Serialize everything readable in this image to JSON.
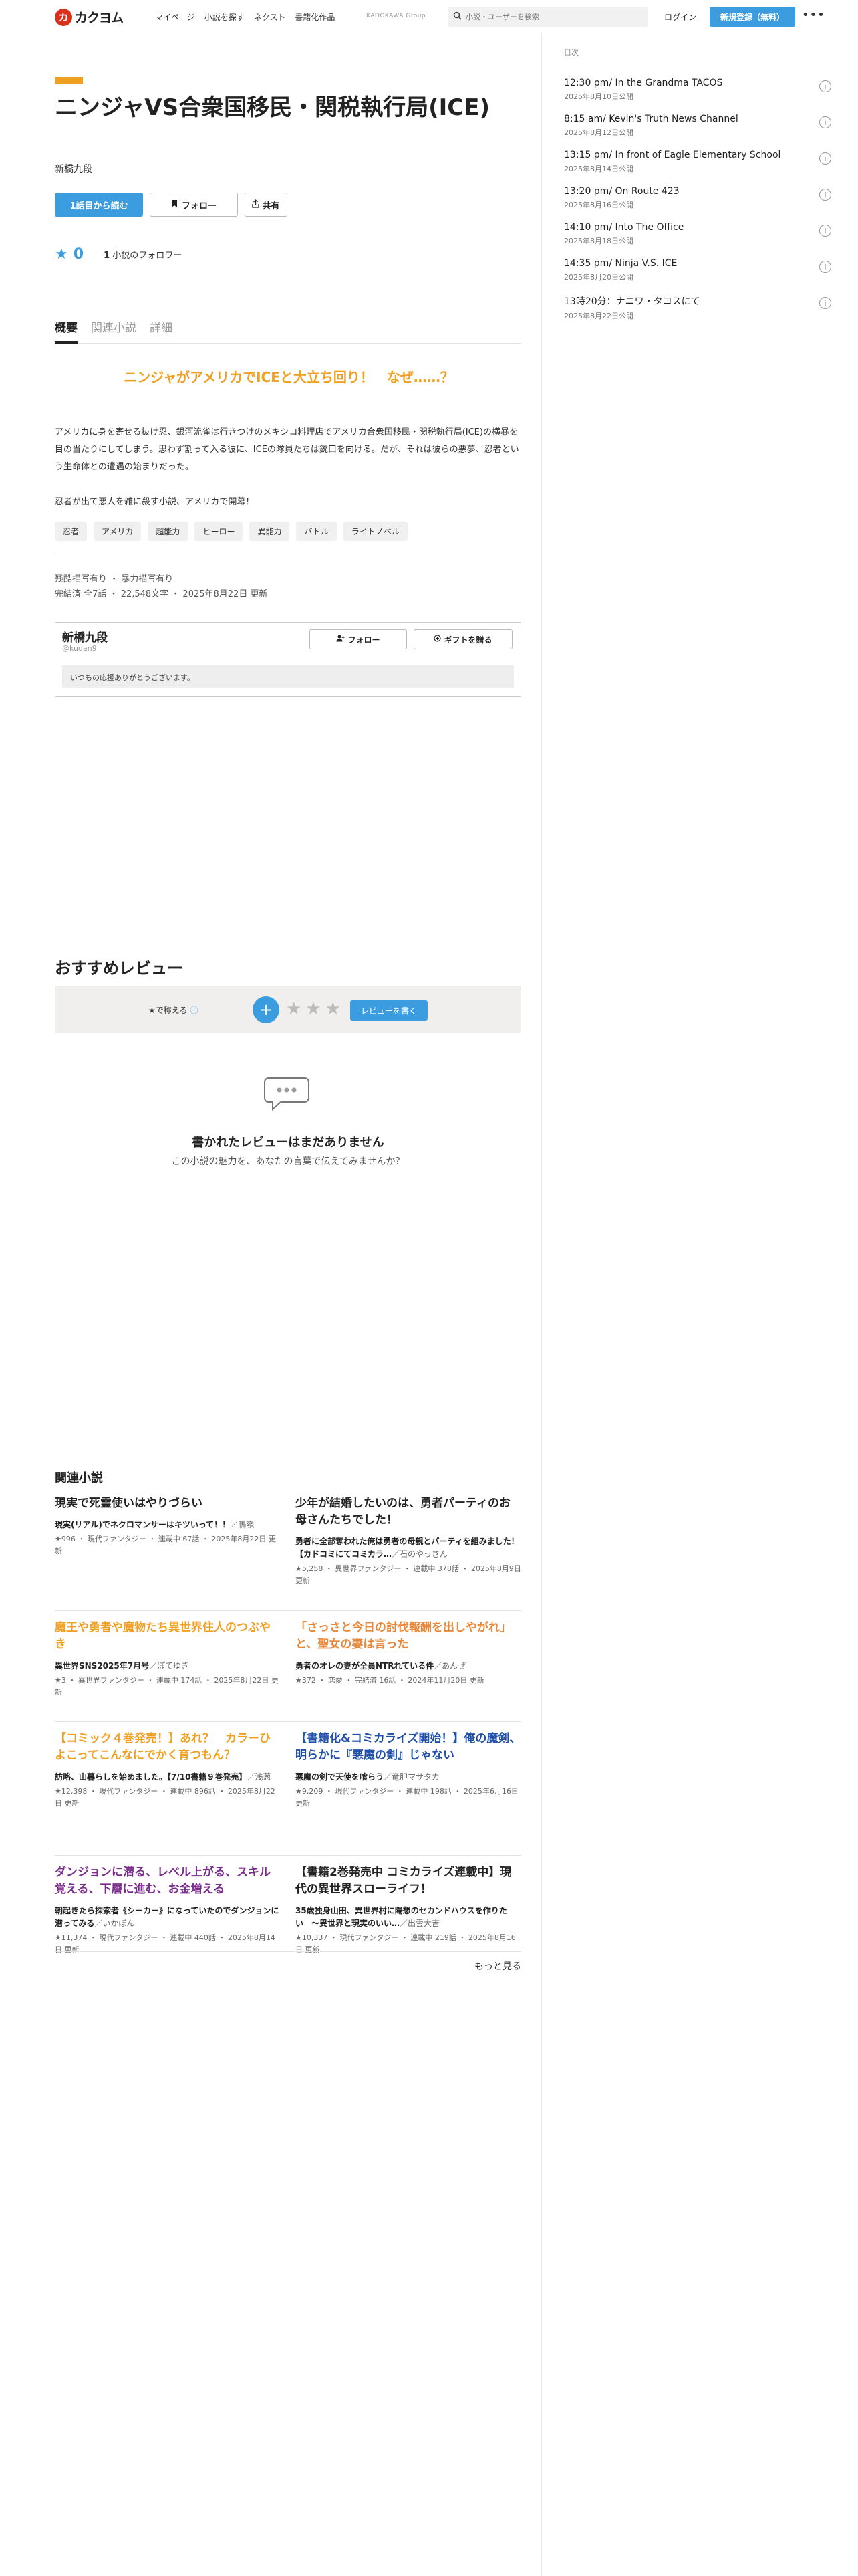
{
  "header": {
    "logo_mark": "カ",
    "logo_text": "カクヨム",
    "nav": [
      "マイページ",
      "小説を探す",
      "ネクスト",
      "書籍化作品"
    ],
    "group": "KADOKAWA Group",
    "search_placeholder": "小説・ユーザーを検索",
    "login": "ログイン",
    "signup": "新規登録（無料）",
    "more": "•••"
  },
  "work": {
    "title": "ニンジャVS合衆国移民・関税執行局(ICE)",
    "author": "新橋九段",
    "read_button": "1話目から読む",
    "follow_button": "フォロー",
    "share_button": "共有",
    "star_count": "0",
    "follower_count": "1",
    "follower_text": "小説のフォロワー"
  },
  "tabs": [
    "概要",
    "関連小説",
    "詳細"
  ],
  "overview": {
    "catchphrase": "ニンジャがアメリカでICEと大立ち回り！　なぜ……？",
    "intro_1": "アメリカに身を寄せる抜け忍、銀河流雀は行きつけのメキシコ料理店でアメリカ合衆国移民・関税執行局(ICE)の横暴を目の当たりにしてしまう。思わず割って入る彼に、ICEの隊員たちは銃口を向ける。だが、それは彼らの悪夢、忍者という生命体との遭遇の始まりだった。",
    "intro_2": "忍者が出て悪人を雑に殺す小説、アメリカで開幕！",
    "tags": [
      "忍者",
      "アメリカ",
      "超能力",
      "ヒーロー",
      "異能力",
      "バトル",
      "ライトノベル"
    ],
    "warnings": "残酷描写有り ・ 暴力描写有り",
    "stats": "完結済 全7話 ・ 22,548文字 ・ 2025年8月22日 更新"
  },
  "author_box": {
    "name": "新橋九段",
    "id": "@kudan9",
    "follow": "フォロー",
    "gift": "ギフトを贈る",
    "message": "いつもの応援ありがとうございます。"
  },
  "reviews": {
    "heading": "おすすめレビュー",
    "label": "★で称える",
    "help": "ⓘ",
    "plus": "+",
    "stars": "★★★",
    "write": "レビューを書く",
    "empty_title": "書かれたレビューはまだありません",
    "empty_sub": "この小説の魅力を、あなたの言葉で伝えてみませんか？"
  },
  "related": {
    "heading": "関連小説",
    "more": "もっと見る",
    "items": [
      {
        "title": "現実で死霊使いはやりづらい",
        "title_color": "#222222",
        "catch": "現実(リアル)でネクロマンサーはキツいって！！",
        "author": "／鴨嶺",
        "meta": "★996 ・ 現代ファンタジー ・ 連載中 67話 ・ 2025年8月22日 更新"
      },
      {
        "title": "少年が結婚したいのは、勇者パーティのお母さんたちでした！",
        "title_color": "#222222",
        "catch": "勇者に全部奪われた俺は勇者の母親とパーティを組みました！【カドコミにてコミカラ…",
        "author": "／石のやっさん",
        "meta": "★5,258 ・ 異世界ファンタジー ・ 連載中 378話 ・ 2025年8月9日 更新"
      },
      {
        "title": "魔王や勇者や魔物たち異世界住人のつぶやき",
        "title_color": "#f0a021",
        "catch": "異世界SNS2025年7月号",
        "author": "／ぽてゆき",
        "meta": "★3 ・ 異世界ファンタジー ・ 連載中 174話 ・ 2025年8月22日 更新"
      },
      {
        "title": "「さっさと今日の討伐報酬を出しやがれ」と、聖女の妻は言った",
        "title_color": "#e8883a",
        "catch": "勇者のオレの妻が全員NTRれている件",
        "author": "／あんぜ",
        "meta": "★372 ・ 恋愛 ・ 完結済 16話 ・ 2024年11月20日 更新"
      },
      {
        "title": "【コミック４巻発売！】あれ？　カラーひよこってこんなにでかく育つもん？",
        "title_color": "#f0a021",
        "catch": "訪略、山暮らしを始めました。【7/10書籍９巻発売】",
        "author": "／浅葱",
        "meta": "★12,398 ・ 現代ファンタジー ・ 連載中 896話 ・ 2025年8月22日 更新"
      },
      {
        "title": "【書籍化&コミカライズ開始！】俺の魔剣、明らかに『悪魔の剣』じゃない",
        "title_color": "#1f4fa8",
        "catch": "悪魔の剣で天使を喰らう",
        "author": "／竜胆マサタカ",
        "meta": "★9,209 ・ 現代ファンタジー ・ 連載中 198話 ・ 2025年6月16日 更新"
      },
      {
        "title": "ダンジョンに潜る、レベル上がる、スキル覚える、下層に進む、お金増える",
        "title_color": "#7a2c8c",
        "catch": "朝起きたら探索者《シーカー》になっていたのでダンジョンに潜ってみる",
        "author": "／いかぽん",
        "meta": "★11,374 ・ 現代ファンタジー ・ 連載中 440話 ・ 2025年8月14日 更新"
      },
      {
        "title": "【書籍2巻発売中 コミカライズ連載中】現代の異世界スローライフ！",
        "title_color": "#222222",
        "catch": "35歳独身山田、異世界村に陽想のセカンドハウスを作りたい　〜異世界と現実のいい…",
        "author": "／出雲大吉",
        "meta": "★10,337 ・ 現代ファンタジー ・ 連載中 219話 ・ 2025年8月16日 更新"
      }
    ]
  },
  "toc": {
    "heading": "目次",
    "items": [
      {
        "title": "12:30 pm/ In the Grandma TACOS",
        "date": "2025年8月10日公開"
      },
      {
        "title": "8:15 am/ Kevin's Truth News Channel",
        "date": "2025年8月12日公開"
      },
      {
        "title": "13:15 pm/ In front of Eagle Elementary School",
        "date": "2025年8月14日公開"
      },
      {
        "title": "13:20 pm/ On Route 423",
        "date": "2025年8月16日公開"
      },
      {
        "title": "14:10 pm/ Into The Office",
        "date": "2025年8月18日公開"
      },
      {
        "title": "14:35 pm/ Ninja V.S. ICE",
        "date": "2025年8月20日公開"
      },
      {
        "title": "13時20分：ナニワ・タコスにて",
        "date": "2025年8月22日公開"
      }
    ]
  }
}
